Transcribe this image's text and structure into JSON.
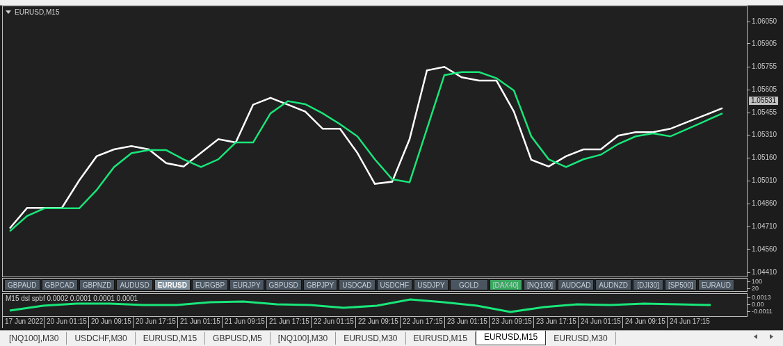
{
  "chart": {
    "title": "EURUSD,M15",
    "current_price": "1.05531",
    "chart_data": {
      "type": "line",
      "ylim": [
        1.0438,
        1.0615
      ],
      "yticks": [
        {
          "value": 1.0605,
          "label": "1.06050"
        },
        {
          "value": 1.05905,
          "label": "1.05905"
        },
        {
          "value": 1.05755,
          "label": "1.05755"
        },
        {
          "value": 1.05605,
          "label": "1.05605"
        },
        {
          "value": 1.05455,
          "label": "1.05455"
        },
        {
          "value": 1.0531,
          "label": "1.05310"
        },
        {
          "value": 1.0516,
          "label": "1.05160"
        },
        {
          "value": 1.0501,
          "label": "1.05010"
        },
        {
          "value": 1.0486,
          "label": "1.04860"
        },
        {
          "value": 1.0471,
          "label": "1.04710"
        },
        {
          "value": 1.0456,
          "label": "1.04560"
        },
        {
          "value": 1.0441,
          "label": "1.04410"
        }
      ],
      "series": [
        {
          "color": "#ffffff",
          "values": [
            1.04699,
            1.04833,
            1.04833,
            1.04833,
            1.05013,
            1.0517,
            1.05215,
            1.05237,
            1.05215,
            1.05125,
            1.05103,
            1.05192,
            1.05282,
            1.0526,
            1.05507,
            1.05552,
            1.05507,
            1.05462,
            1.0535,
            1.0535,
            1.05192,
            1.0499,
            1.05004,
            1.05282,
            1.05731,
            1.05754,
            1.05686,
            1.05664,
            1.05664,
            1.05462,
            1.05147,
            1.05103,
            1.0517,
            1.05215,
            1.05215,
            1.05305,
            1.05327,
            1.05327,
            1.0535,
            1.05395,
            1.05439,
            1.05484
          ]
        },
        {
          "color": "#19e67a",
          "values": [
            1.0468,
            1.0478,
            1.0483,
            1.0483,
            1.0483,
            1.0495,
            1.051,
            1.0519,
            1.0521,
            1.0521,
            1.0515,
            1.051,
            1.0515,
            1.0526,
            1.0526,
            1.0545,
            1.0553,
            1.0551,
            1.0545,
            1.0538,
            1.053,
            1.0515,
            1.0502,
            1.05,
            1.0535,
            1.057,
            1.0572,
            1.0572,
            1.0568,
            1.056,
            1.053,
            1.0515,
            1.051,
            1.0515,
            1.0518,
            1.0525,
            1.053,
            1.0532,
            1.053,
            1.0535,
            1.054,
            1.0545
          ]
        }
      ]
    }
  },
  "symbols": [
    {
      "label": "GBPAUD",
      "selected": false,
      "highlighted": false
    },
    {
      "label": "GBPCAD",
      "selected": false,
      "highlighted": false
    },
    {
      "label": "GBPNZD",
      "selected": false,
      "highlighted": false
    },
    {
      "label": "AUDUSD",
      "selected": false,
      "highlighted": false
    },
    {
      "label": "EURUSD",
      "selected": true,
      "highlighted": false
    },
    {
      "label": "EURGBP",
      "selected": false,
      "highlighted": false
    },
    {
      "label": "EURJPY",
      "selected": false,
      "highlighted": false
    },
    {
      "label": "GBPUSD",
      "selected": false,
      "highlighted": false
    },
    {
      "label": "GBPJPY",
      "selected": false,
      "highlighted": false
    },
    {
      "label": "USDCAD",
      "selected": false,
      "highlighted": false
    },
    {
      "label": "USDCHF",
      "selected": false,
      "highlighted": false
    },
    {
      "label": "USDJPY",
      "selected": false,
      "highlighted": false
    },
    {
      "label": "GOLD",
      "selected": false,
      "highlighted": false
    },
    {
      "label": "[DAX40]",
      "selected": false,
      "highlighted": true
    },
    {
      "label": "[NQ100]",
      "selected": false,
      "highlighted": false
    },
    {
      "label": "AUDCAD",
      "selected": false,
      "highlighted": false
    },
    {
      "label": "AUDNZD",
      "selected": false,
      "highlighted": false
    },
    {
      "label": "[DJI30]",
      "selected": false,
      "highlighted": false
    },
    {
      "label": "[SP500]",
      "selected": false,
      "highlighted": false
    },
    {
      "label": "EURAUD",
      "selected": false,
      "highlighted": false
    }
  ],
  "strip_axis": [
    "100",
    "20"
  ],
  "indicator": {
    "title": "M15 dsl spbf 0.0002 0.0001 0.0001 0.0001",
    "axis_labels": [
      "0.0013",
      "0.00",
      "-0.0011"
    ]
  },
  "time_axis": [
    "17 Jun 2022",
    "20 Jun 01:15",
    "20 Jun 09:15",
    "20 Jun 17:15",
    "21 Jun 01:15",
    "21 Jun 09:15",
    "21 Jun 17:15",
    "22 Jun 01:15",
    "22 Jun 09:15",
    "22 Jun 17:15",
    "23 Jun 01:15",
    "23 Jun 09:15",
    "23 Jun 17:15",
    "24 Jun 01:15",
    "24 Jun 09:15",
    "24 Jun 17:15"
  ],
  "tabs": [
    {
      "label": "[NQ100],M30",
      "selected": false
    },
    {
      "label": "USDCHF,M30",
      "selected": false
    },
    {
      "label": "EURUSD,M15",
      "selected": false
    },
    {
      "label": "GBPUSD,M5",
      "selected": false
    },
    {
      "label": "[NQ100],M30",
      "selected": false
    },
    {
      "label": "EURUSD,M30",
      "selected": false
    },
    {
      "label": "EURUSD,M15",
      "selected": false
    },
    {
      "label": "EURUSD,M15",
      "selected": true
    },
    {
      "label": "EURUSD,M30",
      "selected": false
    }
  ]
}
